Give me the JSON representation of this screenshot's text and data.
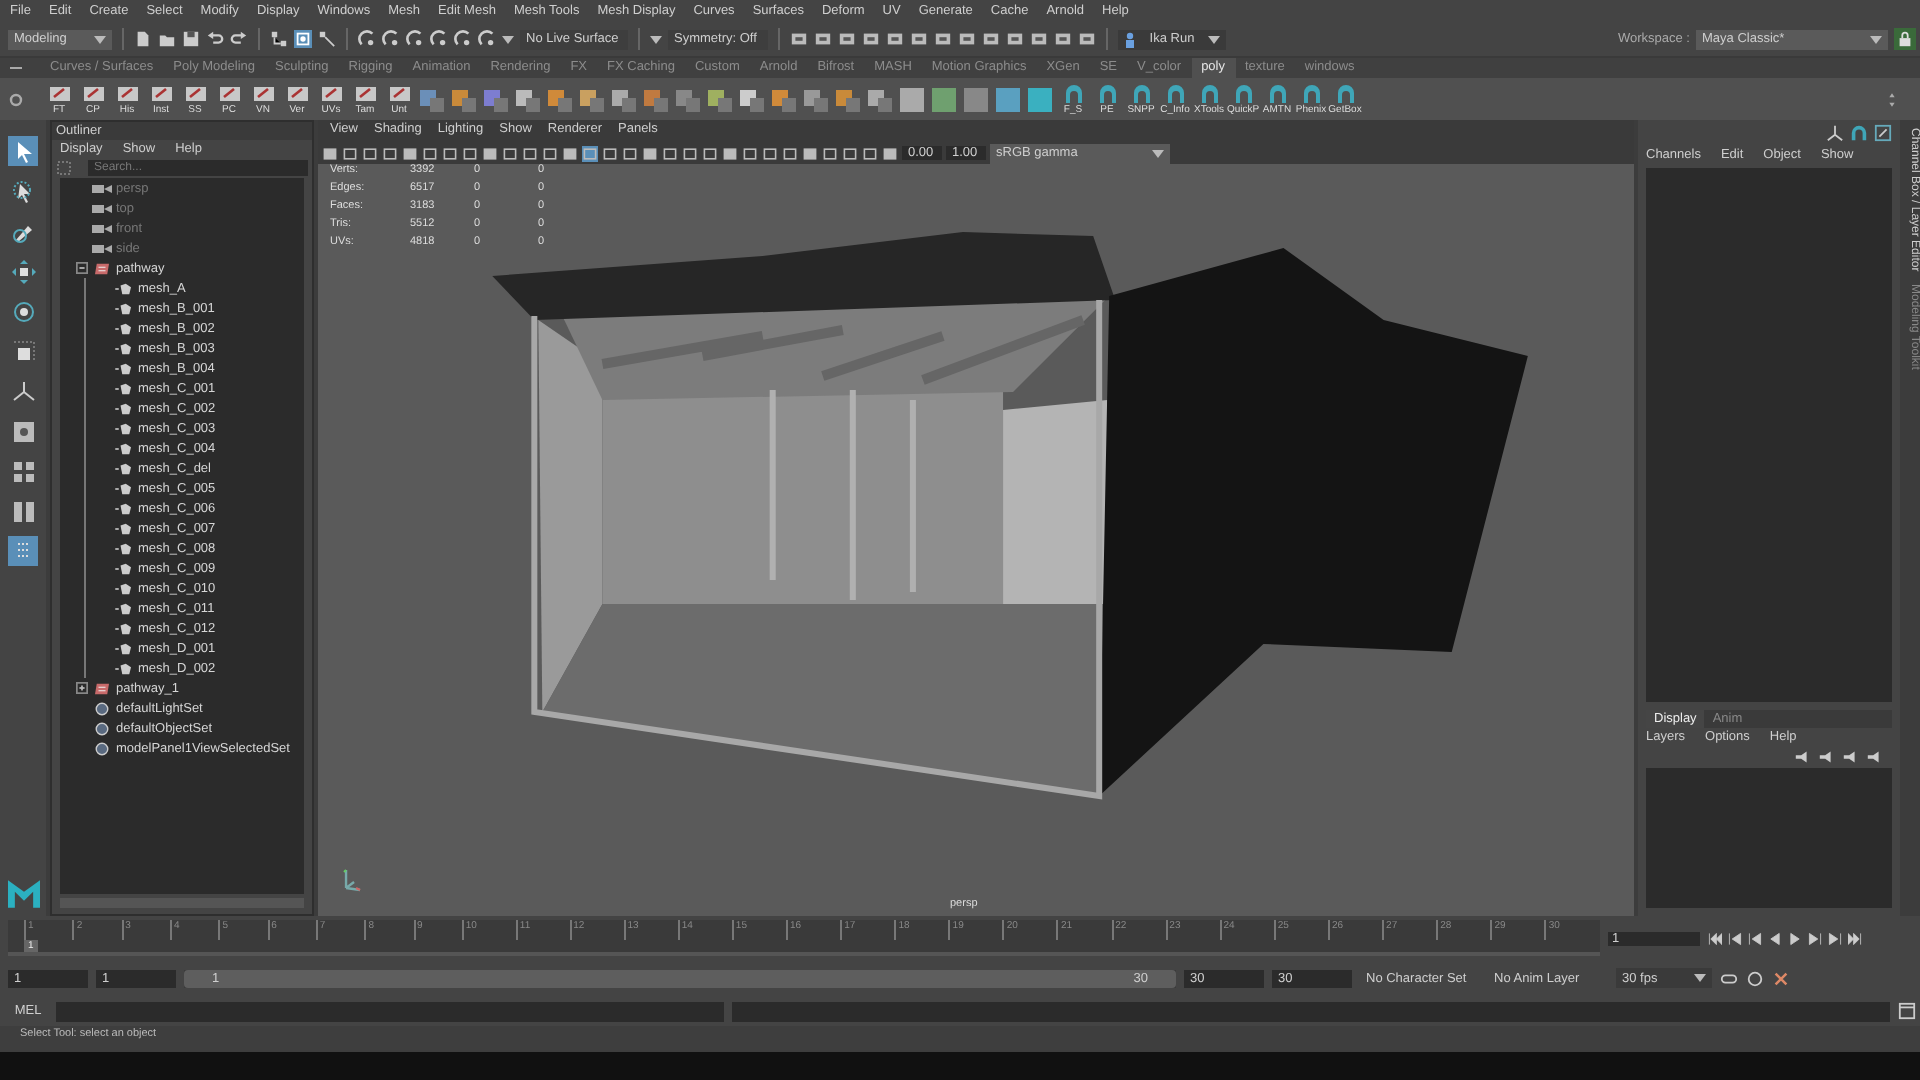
{
  "menu_bar": [
    "File",
    "Edit",
    "Create",
    "Select",
    "Modify",
    "Display",
    "Windows",
    "Mesh",
    "Edit Mesh",
    "Mesh Tools",
    "Mesh Display",
    "Curves",
    "Surfaces",
    "Deform",
    "UV",
    "Generate",
    "Cache",
    "Arnold",
    "Help"
  ],
  "status_line": {
    "mode": "Modeling",
    "live_surface": "No Live Surface",
    "symmetry": "Symmetry: Off",
    "character": "Ika Run",
    "workspace_label": "Workspace :",
    "workspace": "Maya Classic*"
  },
  "shelf_tabs": [
    {
      "label": "Curves / Surfaces",
      "selected": false
    },
    {
      "label": "Poly Modeling",
      "selected": false
    },
    {
      "label": "Sculpting",
      "selected": false
    },
    {
      "label": "Rigging",
      "selected": false
    },
    {
      "label": "Animation",
      "selected": false
    },
    {
      "label": "Rendering",
      "selected": false
    },
    {
      "label": "FX",
      "selected": false
    },
    {
      "label": "FX Caching",
      "selected": false
    },
    {
      "label": "Custom",
      "selected": false
    },
    {
      "label": "Arnold",
      "selected": false
    },
    {
      "label": "Bifrost",
      "selected": false
    },
    {
      "label": "MASH",
      "selected": false
    },
    {
      "label": "Motion Graphics",
      "selected": false
    },
    {
      "label": "XGen",
      "selected": false
    },
    {
      "label": "SE",
      "selected": false
    },
    {
      "label": "V_color",
      "selected": false
    },
    {
      "label": "poly",
      "selected": true
    },
    {
      "label": "texture",
      "selected": false
    },
    {
      "label": "windows",
      "selected": false
    }
  ],
  "shelf_buttons_left": [
    "FT",
    "CP",
    "His",
    "Inst",
    "SS",
    "PC",
    "VN",
    "Ver",
    "UVs",
    "Tam",
    "Unt"
  ],
  "shelf_buttons_right": [
    "F_S",
    "PE",
    "SNPP",
    "C_Info",
    "XTools",
    "QuickP",
    "AMTN",
    "Phenix",
    "GetBox"
  ],
  "toolbox": [
    {
      "kind": "select",
      "selected": true
    },
    {
      "kind": "lasso",
      "selected": false
    },
    {
      "kind": "paint",
      "selected": false
    },
    {
      "kind": "move",
      "selected": false
    },
    {
      "kind": "rotate",
      "selected": false
    },
    {
      "kind": "scale",
      "selected": false
    },
    {
      "kind": "axis",
      "selected": false
    },
    {
      "kind": "single",
      "selected": false
    },
    {
      "kind": "quad",
      "selected": false
    },
    {
      "kind": "split",
      "selected": false
    },
    {
      "kind": "outliner",
      "selected": true
    }
  ],
  "outliner": {
    "title": "Outliner",
    "menu": [
      "Display",
      "Show",
      "Help"
    ],
    "search": {
      "placeholder": "Search..."
    },
    "items": [
      {
        "kind": "camera",
        "name": "persp",
        "hidden": true
      },
      {
        "kind": "camera",
        "name": "top",
        "hidden": true
      },
      {
        "kind": "camera",
        "name": "front",
        "hidden": true
      },
      {
        "kind": "camera",
        "name": "side",
        "hidden": true
      },
      {
        "kind": "group",
        "name": "pathway",
        "hidden": false,
        "expanded": true,
        "children": [
          {
            "kind": "mesh",
            "name": "mesh_A"
          },
          {
            "kind": "mesh",
            "name": "mesh_B_001"
          },
          {
            "kind": "mesh",
            "name": "mesh_B_002"
          },
          {
            "kind": "mesh",
            "name": "mesh_B_003"
          },
          {
            "kind": "mesh",
            "name": "mesh_B_004"
          },
          {
            "kind": "mesh",
            "name": "mesh_C_001"
          },
          {
            "kind": "mesh",
            "name": "mesh_C_002"
          },
          {
            "kind": "mesh",
            "name": "mesh_C_003"
          },
          {
            "kind": "mesh",
            "name": "mesh_C_004"
          },
          {
            "kind": "mesh",
            "name": "mesh_C_del"
          },
          {
            "kind": "mesh",
            "name": "mesh_C_005"
          },
          {
            "kind": "mesh",
            "name": "mesh_C_006"
          },
          {
            "kind": "mesh",
            "name": "mesh_C_007"
          },
          {
            "kind": "mesh",
            "name": "mesh_C_008"
          },
          {
            "kind": "mesh",
            "name": "mesh_C_009"
          },
          {
            "kind": "mesh",
            "name": "mesh_C_010"
          },
          {
            "kind": "mesh",
            "name": "mesh_C_011"
          },
          {
            "kind": "mesh",
            "name": "mesh_C_012"
          },
          {
            "kind": "mesh",
            "name": "mesh_D_001"
          },
          {
            "kind": "mesh",
            "name": "mesh_D_002"
          }
        ]
      },
      {
        "kind": "group",
        "name": "pathway_1",
        "hidden": false,
        "expanded": false
      },
      {
        "kind": "set",
        "name": "defaultLightSet",
        "hidden": false
      },
      {
        "kind": "set",
        "name": "defaultObjectSet",
        "hidden": false
      },
      {
        "kind": "set",
        "name": "modelPanel1ViewSelectedSet",
        "hidden": false
      }
    ]
  },
  "viewport": {
    "menu": [
      "View",
      "Shading",
      "Lighting",
      "Show",
      "Renderer",
      "Panels"
    ],
    "exposure": "0.00",
    "gamma": "1.00",
    "color_space": "sRGB gamma",
    "hud": [
      {
        "label": "Verts:",
        "values": [
          "3392",
          "0",
          "0"
        ]
      },
      {
        "label": "Edges:",
        "values": [
          "6517",
          "0",
          "0"
        ]
      },
      {
        "label": "Faces:",
        "values": [
          "3183",
          "0",
          "0"
        ]
      },
      {
        "label": "Tris:",
        "values": [
          "5512",
          "0",
          "0"
        ]
      },
      {
        "label": "UVs:",
        "values": [
          "4818",
          "0",
          "0"
        ]
      }
    ],
    "camera": "persp"
  },
  "channel_box": {
    "menu": [
      "Channels",
      "Edit",
      "Object",
      "Show"
    ],
    "side_tabs": [
      "Channel Box / Layer Editor",
      "Modeling Toolkit"
    ]
  },
  "layer_editor": {
    "tabs": [
      {
        "label": "Display",
        "selected": true
      },
      {
        "label": "Anim",
        "selected": false
      }
    ],
    "menu": [
      "Layers",
      "Options",
      "Help"
    ]
  },
  "timeline": {
    "ticks": [
      "1",
      "2",
      "3",
      "4",
      "5",
      "6",
      "7",
      "8",
      "9",
      "10",
      "11",
      "12",
      "13",
      "14",
      "15",
      "16",
      "17",
      "18",
      "19",
      "20",
      "21",
      "22",
      "23",
      "24",
      "25",
      "26",
      "27",
      "28",
      "29",
      "30"
    ],
    "current": "1",
    "level": 0,
    "frame_field": "1"
  },
  "range": {
    "start": "1",
    "playback_start": "1",
    "slider_start": "1",
    "slider_end": "30",
    "level": 1,
    "playback_end": "30",
    "end": "30",
    "character_set": "No Character Set",
    "anim_layer": "No Anim Layer",
    "fps": "30 fps"
  },
  "command_line": {
    "label": "MEL"
  },
  "help_line": "Select Tool: select an object"
}
